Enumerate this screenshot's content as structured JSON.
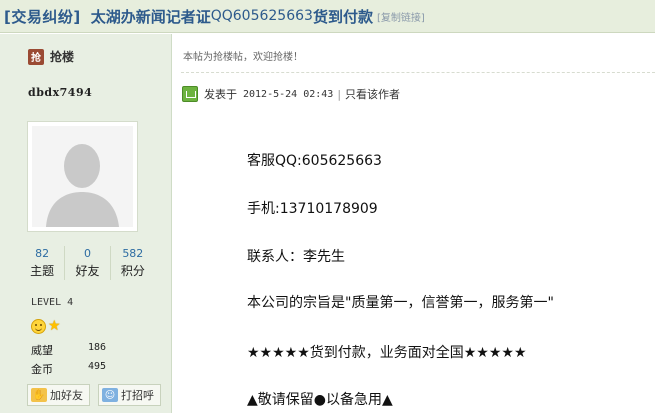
{
  "title": {
    "category": "[交易纠纷]",
    "main": "太湖办新闻记者证",
    "qq": "QQ605625663",
    "tail": "货到付款",
    "copy_link": "[复制链接]"
  },
  "author": {
    "floor_icon": "抢",
    "floor_label": "抢楼",
    "username": "dbdx7494",
    "stats": [
      {
        "num": "82",
        "label": "主题"
      },
      {
        "num": "0",
        "label": "好友"
      },
      {
        "num": "582",
        "label": "积分"
      }
    ],
    "level": "LEVEL 4",
    "medals": [
      "smile-icon",
      "star-icon"
    ],
    "fields": [
      {
        "key": "威望",
        "value": "186"
      },
      {
        "key": "金币",
        "value": "495"
      }
    ],
    "buttons": {
      "add_friend": "加好友",
      "greet": "打招呼"
    }
  },
  "post": {
    "notice": "本帖为抢楼帖，欢迎抢楼！",
    "posted_label": "发表于",
    "posted_time": "2012-5-24 02:43",
    "separator": "|",
    "author_only": "只看该作者",
    "lines": [
      "客服QQ:605625663",
      "手机:13710178909",
      "联系人：李先生",
      "本公司的宗旨是\"质量第一，信誉第一，服务第一\"",
      "★★★★★货到付款，业务面对全国★★★★★",
      "▲敬请保留●以备急用▲"
    ]
  },
  "colors": {
    "title_bg": "#e7eedd",
    "title_text": "#2d5a8c",
    "sidebar_bg": "#e8efe3",
    "link_blue": "#2d6ca2"
  }
}
